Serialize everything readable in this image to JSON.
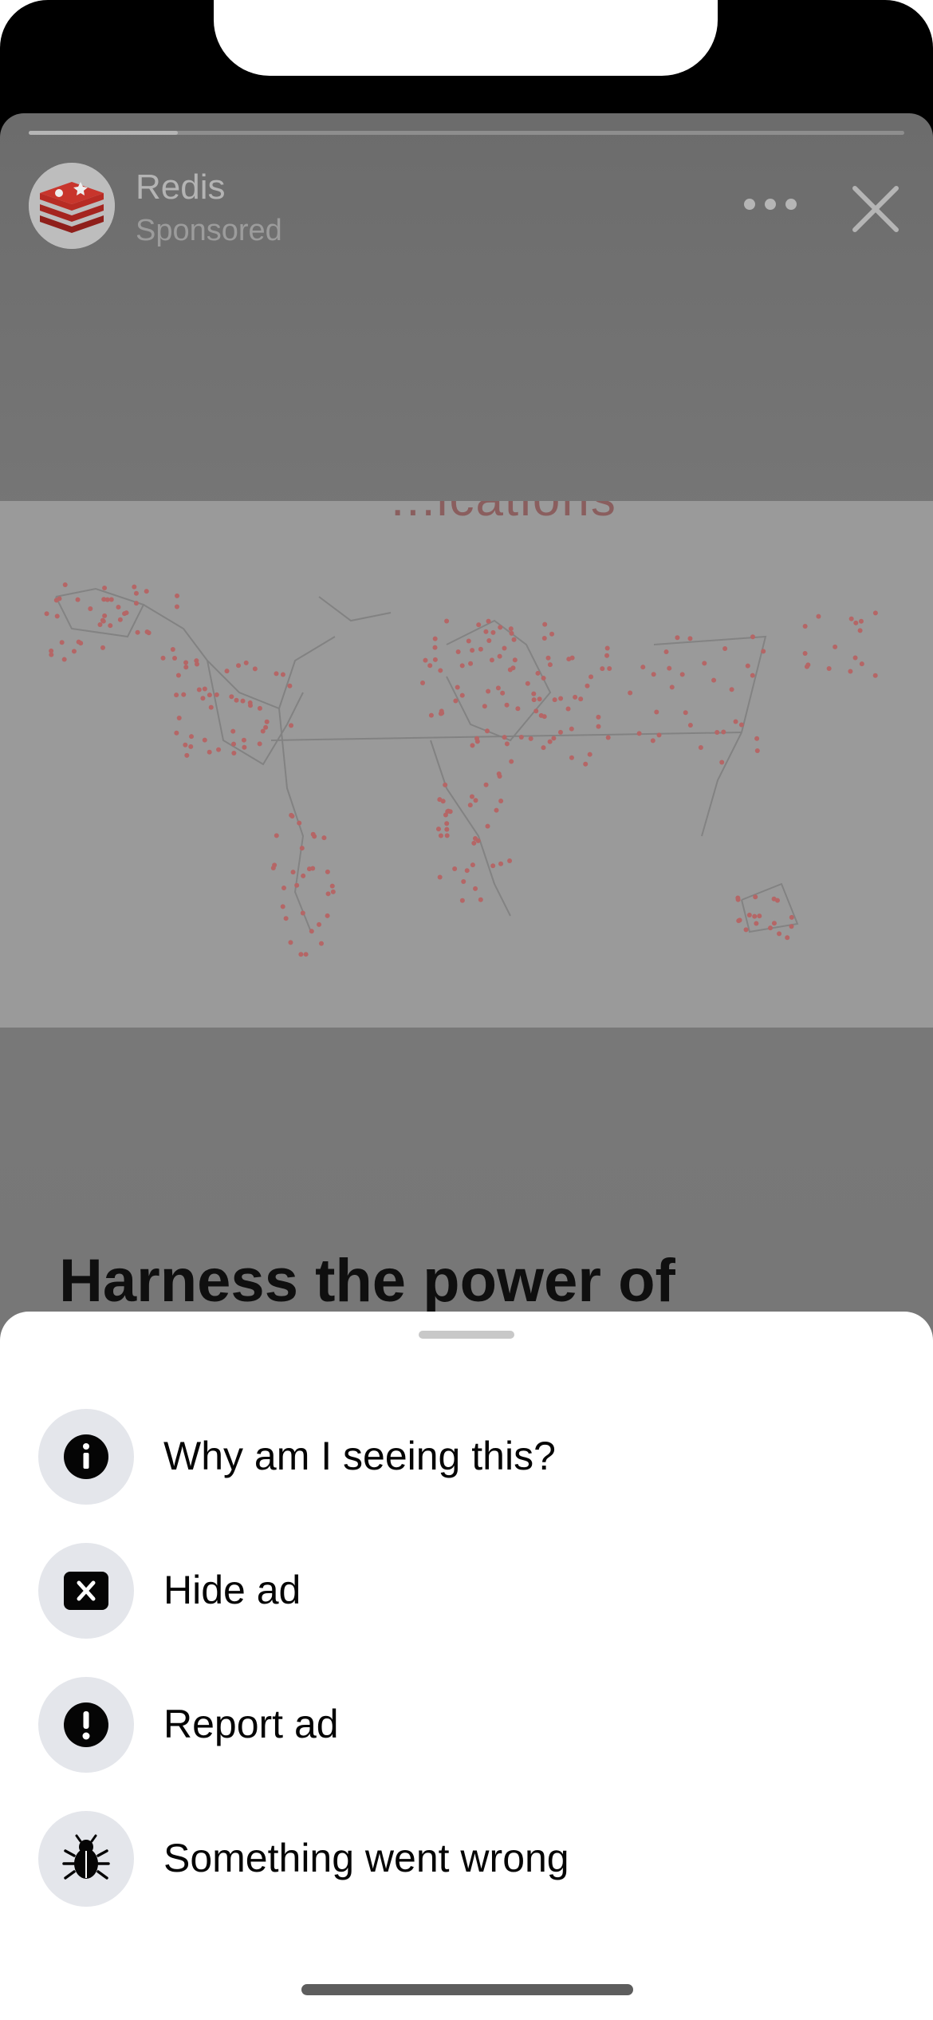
{
  "story": {
    "progress": 0.17,
    "brand_name": "Redis",
    "sponsored_label": "Sponsored",
    "media_caption_partial": "...ications",
    "headline": "Harness the power of"
  },
  "menu": {
    "items": [
      {
        "label": "Why am I seeing this?",
        "icon": "info-icon"
      },
      {
        "label": "Hide ad",
        "icon": "hide-box-icon"
      },
      {
        "label": "Report ad",
        "icon": "alert-icon"
      },
      {
        "label": "Something went wrong",
        "icon": "bug-icon"
      }
    ]
  },
  "colors": {
    "overlay": "#777777",
    "sheet_background": "#ffffff",
    "icon_circle": "#e4e6eb",
    "map_dots": "#c0392b"
  }
}
